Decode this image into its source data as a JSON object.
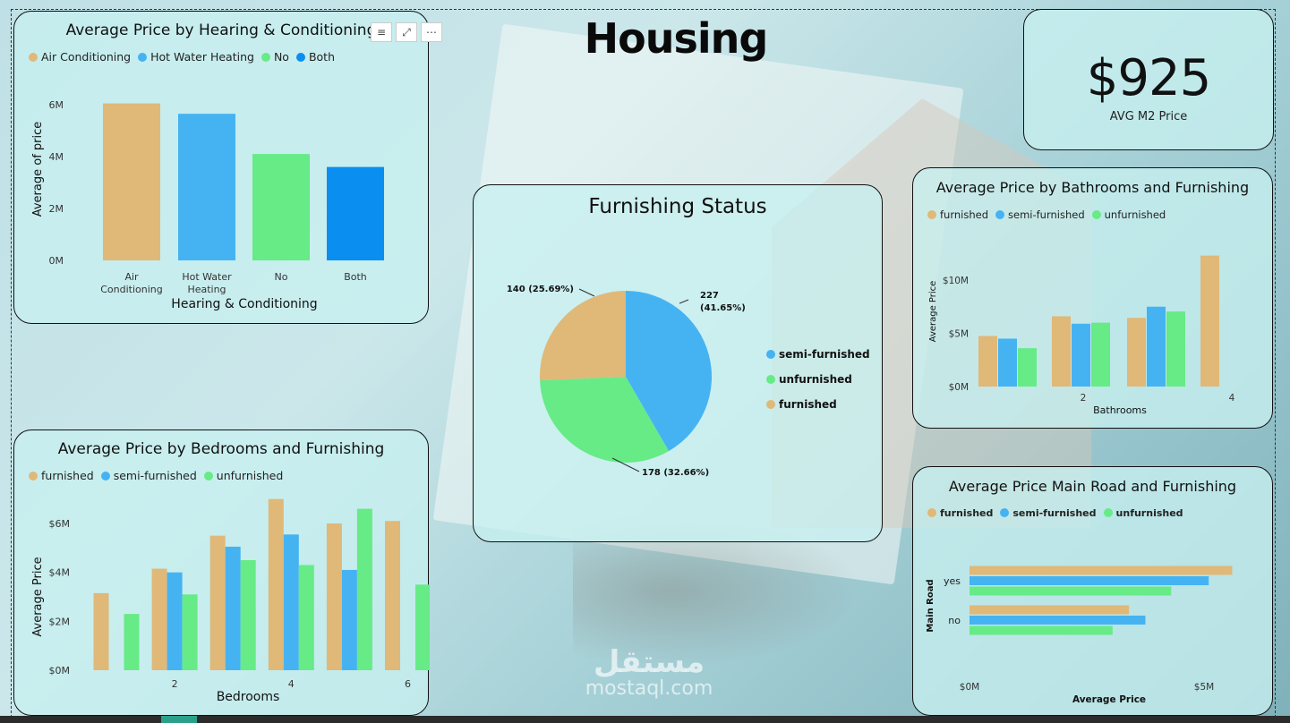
{
  "page": {
    "title": "Housing"
  },
  "kpi": {
    "value": "$925",
    "label": "AVG M2 Price"
  },
  "watermark": {
    "line1": "مستقل",
    "line2": "mostaql.com"
  },
  "colors": {
    "tan": "#e0b878",
    "blue": "#45b3f2",
    "green": "#66eb87",
    "dark_blue": "#0a8ef0"
  },
  "visual_header": {
    "icons": [
      "filter-icon",
      "focus-mode-icon",
      "more-options-icon"
    ],
    "glyphs": [
      "≡",
      "⤢",
      "⋯"
    ]
  },
  "chart_data": [
    {
      "id": "hearing",
      "type": "bar",
      "title": "Average Price by Hearing & Conditioning",
      "legend": [
        "Air Conditioning",
        "Hot Water Heating",
        "No",
        "Both"
      ],
      "categories": [
        "Air Conditioning",
        "Hot Water Heating",
        "No",
        "Both"
      ],
      "category_lines": [
        [
          "Air",
          "Conditioning"
        ],
        [
          "Hot Water",
          "Heating"
        ],
        [
          "No"
        ],
        [
          "Both"
        ]
      ],
      "values": [
        6.05,
        5.65,
        4.1,
        3.6
      ],
      "xlabel": "Hearing & Conditioning",
      "ylabel": "Average of price",
      "yticks": [
        "0M",
        "2M",
        "4M",
        "6M"
      ],
      "ylim": [
        0,
        6.05
      ],
      "grid": false
    },
    {
      "id": "bedrooms",
      "type": "bar",
      "title": "Average Price by Bedrooms and Furnishing",
      "legend": [
        "furnished",
        "semi-furnished",
        "unfurnished"
      ],
      "categories": [
        1,
        2,
        3,
        4,
        5,
        6
      ],
      "xticks": [
        "2",
        "4",
        "6"
      ],
      "series": [
        {
          "name": "furnished",
          "values": [
            3.15,
            4.15,
            5.5,
            7.0,
            6.0,
            6.1
          ]
        },
        {
          "name": "semi-furnished",
          "values": [
            null,
            4.0,
            5.05,
            5.55,
            4.1,
            null
          ]
        },
        {
          "name": "unfurnished",
          "values": [
            2.3,
            3.1,
            4.5,
            4.3,
            6.6,
            3.5
          ]
        }
      ],
      "xlabel": "Bedrooms",
      "ylabel": "Average Price",
      "yticks": [
        "$0M",
        "$2M",
        "$4M",
        "$6M"
      ],
      "ylim": [
        0,
        7.0
      ],
      "grid": false
    },
    {
      "id": "furnishing",
      "type": "pie",
      "title": "Furnishing Status",
      "legend": [
        "semi-furnished",
        "unfurnished",
        "furnished"
      ],
      "slices": [
        {
          "name": "semi-furnished",
          "value": 227,
          "label": [
            "227",
            "(41.65%)"
          ]
        },
        {
          "name": "unfurnished",
          "value": 178,
          "label": [
            "178 (32.66%)"
          ]
        },
        {
          "name": "furnished",
          "value": 140,
          "label": [
            "140 (25.69%)"
          ]
        }
      ]
    },
    {
      "id": "bathrooms",
      "type": "bar",
      "title": "Average Price by Bathrooms and Furnishing",
      "legend": [
        "furnished",
        "semi-furnished",
        "unfurnished"
      ],
      "categories": [
        1,
        2,
        3,
        4
      ],
      "xticks": [
        "2",
        "4"
      ],
      "series": [
        {
          "name": "furnished",
          "values": [
            4.75,
            6.6,
            6.45,
            12.3
          ]
        },
        {
          "name": "semi-furnished",
          "values": [
            4.5,
            5.9,
            7.5,
            null
          ]
        },
        {
          "name": "unfurnished",
          "values": [
            3.6,
            6.0,
            7.05,
            null
          ]
        }
      ],
      "xlabel": "Bathrooms",
      "ylabel": "Average Price",
      "yticks": [
        "$0M",
        "$5M",
        "$10M"
      ],
      "ylim": [
        0,
        12.3
      ],
      "grid": false
    },
    {
      "id": "mainroad",
      "type": "bar",
      "orientation": "horizontal",
      "title": "Average Price Main Road and Furnishing",
      "legend": [
        "furnished",
        "semi-furnished",
        "unfurnished"
      ],
      "categories": [
        "yes",
        "no"
      ],
      "series": [
        {
          "name": "furnished",
          "values": [
            5.6,
            3.4
          ]
        },
        {
          "name": "semi-furnished",
          "values": [
            5.1,
            3.75
          ]
        },
        {
          "name": "unfurnished",
          "values": [
            4.3,
            3.05
          ]
        }
      ],
      "xlabel": "Average Price",
      "ylabel": "Main Road",
      "xticks": [
        "$0M",
        "$5M"
      ],
      "xlim": [
        0,
        5.0
      ],
      "grid": false
    }
  ]
}
